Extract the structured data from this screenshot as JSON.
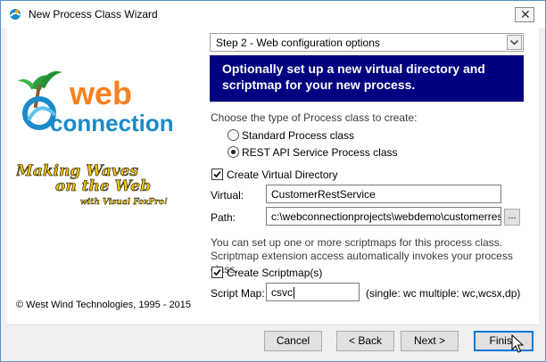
{
  "window": {
    "title": "New Process Class Wizard",
    "close_glyph": "✕"
  },
  "logo": {
    "web": "web",
    "connection": "connection",
    "tagline1": "Making Waves",
    "tagline2": "on the Web",
    "tagline3": "with Visual FoxPro!"
  },
  "copyright": "© West Wind Technologies, 1995 - 2015",
  "step": {
    "selected": "Step 2 - Web configuration options"
  },
  "banner": "Optionally set up a new virtual directory and scriptmap for your new process.",
  "process_type": {
    "prompt": "Choose the type of Process class to create:",
    "options": [
      {
        "label": "Standard Process class",
        "selected": false
      },
      {
        "label": "REST API Service Process class",
        "selected": true
      }
    ]
  },
  "virtual_dir": {
    "checkbox_label": "Create Virtual Directory",
    "checked": true,
    "virtual_label": "Virtual:",
    "virtual_value": "CustomerRestService",
    "path_label": "Path:",
    "path_value": "c:\\webconnectionprojects\\webdemo\\customerrestser",
    "browse_label": "..."
  },
  "scriptmap": {
    "info": "You can set up one or more scriptmaps for this process class. Scriptmap extension access automatically invokes your process class.",
    "checkbox_label": "Create Scriptmap(s)",
    "checked": true,
    "label": "Script Map:",
    "value": "csvc",
    "hint": "(single: wc   multiple: wc,wcsx,dp)"
  },
  "buttons": {
    "cancel": "Cancel",
    "back": "< Back",
    "next": "Next >",
    "finish": "Finish"
  },
  "colors": {
    "banner_bg": "#000080",
    "logo_orange": "#f58220",
    "logo_blue": "#1a8ac9",
    "focus_blue": "#0078d7"
  }
}
